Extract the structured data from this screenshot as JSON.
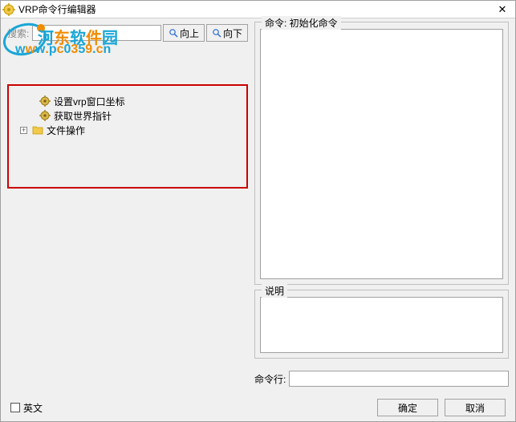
{
  "window": {
    "title": "VRP命令行编辑器"
  },
  "search": {
    "label": "搜索:",
    "value": "",
    "up": "向上",
    "down": "向下"
  },
  "tree": {
    "items": [
      {
        "label": "设置vrp窗口坐标"
      },
      {
        "label": "获取世界指针"
      }
    ],
    "folder_label": "文件操作"
  },
  "panels": {
    "command_title_prefix": "命令: ",
    "command_title_value": "初始化命令",
    "description_title": "说明",
    "cmdline_label": "命令行:",
    "cmdline_value": ""
  },
  "footer": {
    "english_label": "英文",
    "ok": "确定",
    "cancel": "取消"
  },
  "watermark": {
    "text1": "河东软件园",
    "url": "www.pc0359.cn",
    "colors": [
      "#1aa6d6",
      "#f08c00",
      "#1aa6d6",
      "#f08c00",
      "#1aa6d6",
      "#f08c00",
      "#1aa6d6",
      "#f08c00",
      "#1aa6d6",
      "#f08c00",
      "#1aa6d6",
      "#f08c00",
      "#1aa6d6",
      "#f08c00"
    ]
  }
}
